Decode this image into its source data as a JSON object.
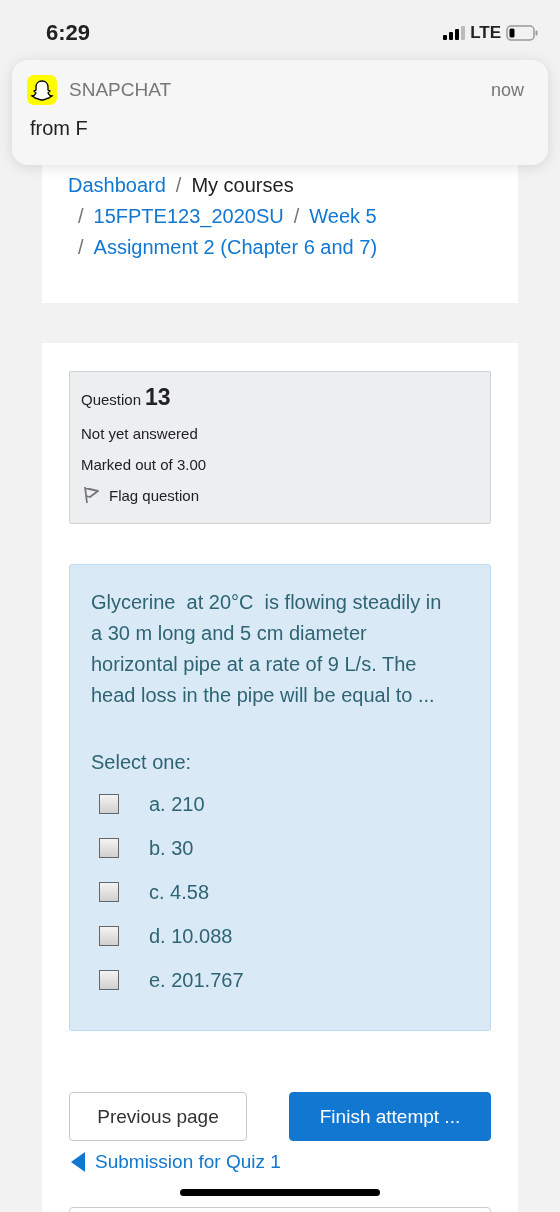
{
  "status_bar": {
    "time": "6:29",
    "network": "LTE"
  },
  "notification": {
    "app": "SNAPCHAT",
    "time": "now",
    "message": "from F"
  },
  "breadcrumb": [
    {
      "label": "Dashboard",
      "link": true
    },
    {
      "separator": "/",
      "label": "My courses",
      "link": false
    },
    {
      "separator": "/",
      "label": "15FPTE123_2020SU",
      "link": true
    },
    {
      "separator": "/",
      "label": "Week 5",
      "link": true
    },
    {
      "separator": "/",
      "label": "Assignment 2 (Chapter 6 and 7)",
      "link": true
    }
  ],
  "question_info": {
    "label": "Question",
    "number": "13",
    "state": "Not yet answered",
    "marks": "Marked out of 3.00",
    "flag": {
      "label": "Flag question",
      "flagged": false
    }
  },
  "question": {
    "text": "Glycerine  at 20°C  is flowing steadily in a 30 m long and 5 cm diameter horizontal pipe at a rate of 9 L/s. The head loss in the pipe will be equal to ...",
    "prompt": "Select one:",
    "options": [
      {
        "label": "a. 210",
        "checked": false
      },
      {
        "label": "b. 30",
        "checked": false
      },
      {
        "label": "c. 4.58",
        "checked": false
      },
      {
        "label": "d. 10.088",
        "checked": false
      },
      {
        "label": "e. 201.767",
        "checked": false
      }
    ]
  },
  "buttons": [
    {
      "label": "Previous page",
      "kind": "secondary"
    },
    {
      "label": "Finish attempt ...",
      "kind": "primary"
    }
  ],
  "prev_link": "Submission for Quiz 1"
}
